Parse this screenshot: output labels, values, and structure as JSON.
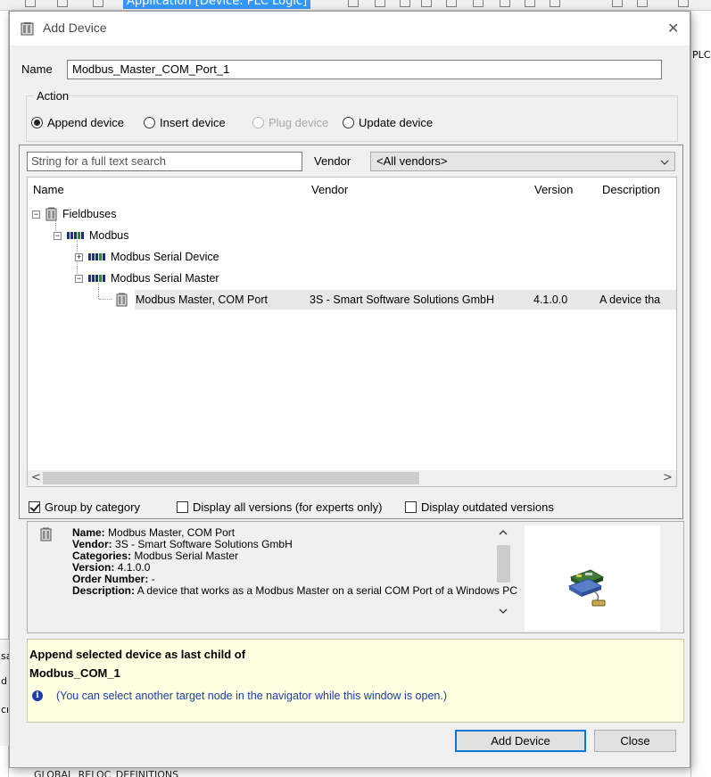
{
  "background": {
    "app_title": "Application [Device: PLC Logic]",
    "right_label": "PLC",
    "left_labels": [
      "sa",
      "d",
      "cı"
    ],
    "bottom_text": "GLOBAL_RELOC_DEFINITIONS"
  },
  "dialog": {
    "title": "Add Device",
    "name_label": "Name",
    "name_value": "Modbus_Master_COM_Port_1",
    "action": {
      "label": "Action",
      "options": [
        {
          "label": "Append device",
          "checked": true,
          "enabled": true
        },
        {
          "label": "Insert device",
          "checked": false,
          "enabled": true
        },
        {
          "label": "Plug device",
          "checked": false,
          "enabled": false
        },
        {
          "label": "Update device",
          "checked": false,
          "enabled": true
        }
      ]
    },
    "search": {
      "placeholder": "String for a full text search"
    },
    "vendor": {
      "label": "Vendor",
      "selected": "<All vendors>"
    },
    "tree": {
      "columns": [
        "Name",
        "Vendor",
        "Version",
        "Description"
      ],
      "items": [
        {
          "label": "Fieldbuses",
          "expander": "−",
          "icon": "fieldbus-icon"
        },
        {
          "label": "Modbus",
          "expander": "−",
          "icon": "modbus-icon"
        },
        {
          "label": "Modbus Serial Device",
          "expander": "+",
          "icon": "modbus-icon"
        },
        {
          "label": "Modbus Serial Master",
          "expander": "−",
          "icon": "modbus-icon"
        }
      ],
      "selected_device": {
        "name": "Modbus Master, COM Port",
        "vendor": "3S - Smart Software Solutions GmbH",
        "version": "4.1.0.0",
        "description": "A device tha"
      }
    },
    "checkboxes": [
      {
        "label": "Group by category",
        "checked": true
      },
      {
        "label": "Display all versions (for experts only)",
        "checked": false
      },
      {
        "label": "Display outdated versions",
        "checked": false
      }
    ],
    "info": {
      "name_label": "Name:",
      "name": "Modbus Master, COM Port",
      "vendor_label": "Vendor:",
      "vendor": "3S - Smart Software Solutions GmbH",
      "categories_label": "Categories:",
      "categories": "Modbus Serial Master",
      "version_label": "Version:",
      "version": "4.1.0.0",
      "order_label": "Order Number:",
      "order": "-",
      "description_label": "Description:",
      "description": "A device that works as a Modbus Master on a serial COM Port of a Windows PC"
    },
    "append": {
      "line1": "Append selected device as last child of",
      "line2": "Modbus_COM_1",
      "hint": "(You can select another target node in the navigator while this window is open.)"
    },
    "buttons": {
      "add": "Add Device",
      "close": "Close"
    }
  },
  "colors": {
    "accent": "#0078d7",
    "app_highlight": "#3399ff",
    "hint_blue": "#1a3ea8",
    "append_bg": "#ffffe1"
  }
}
